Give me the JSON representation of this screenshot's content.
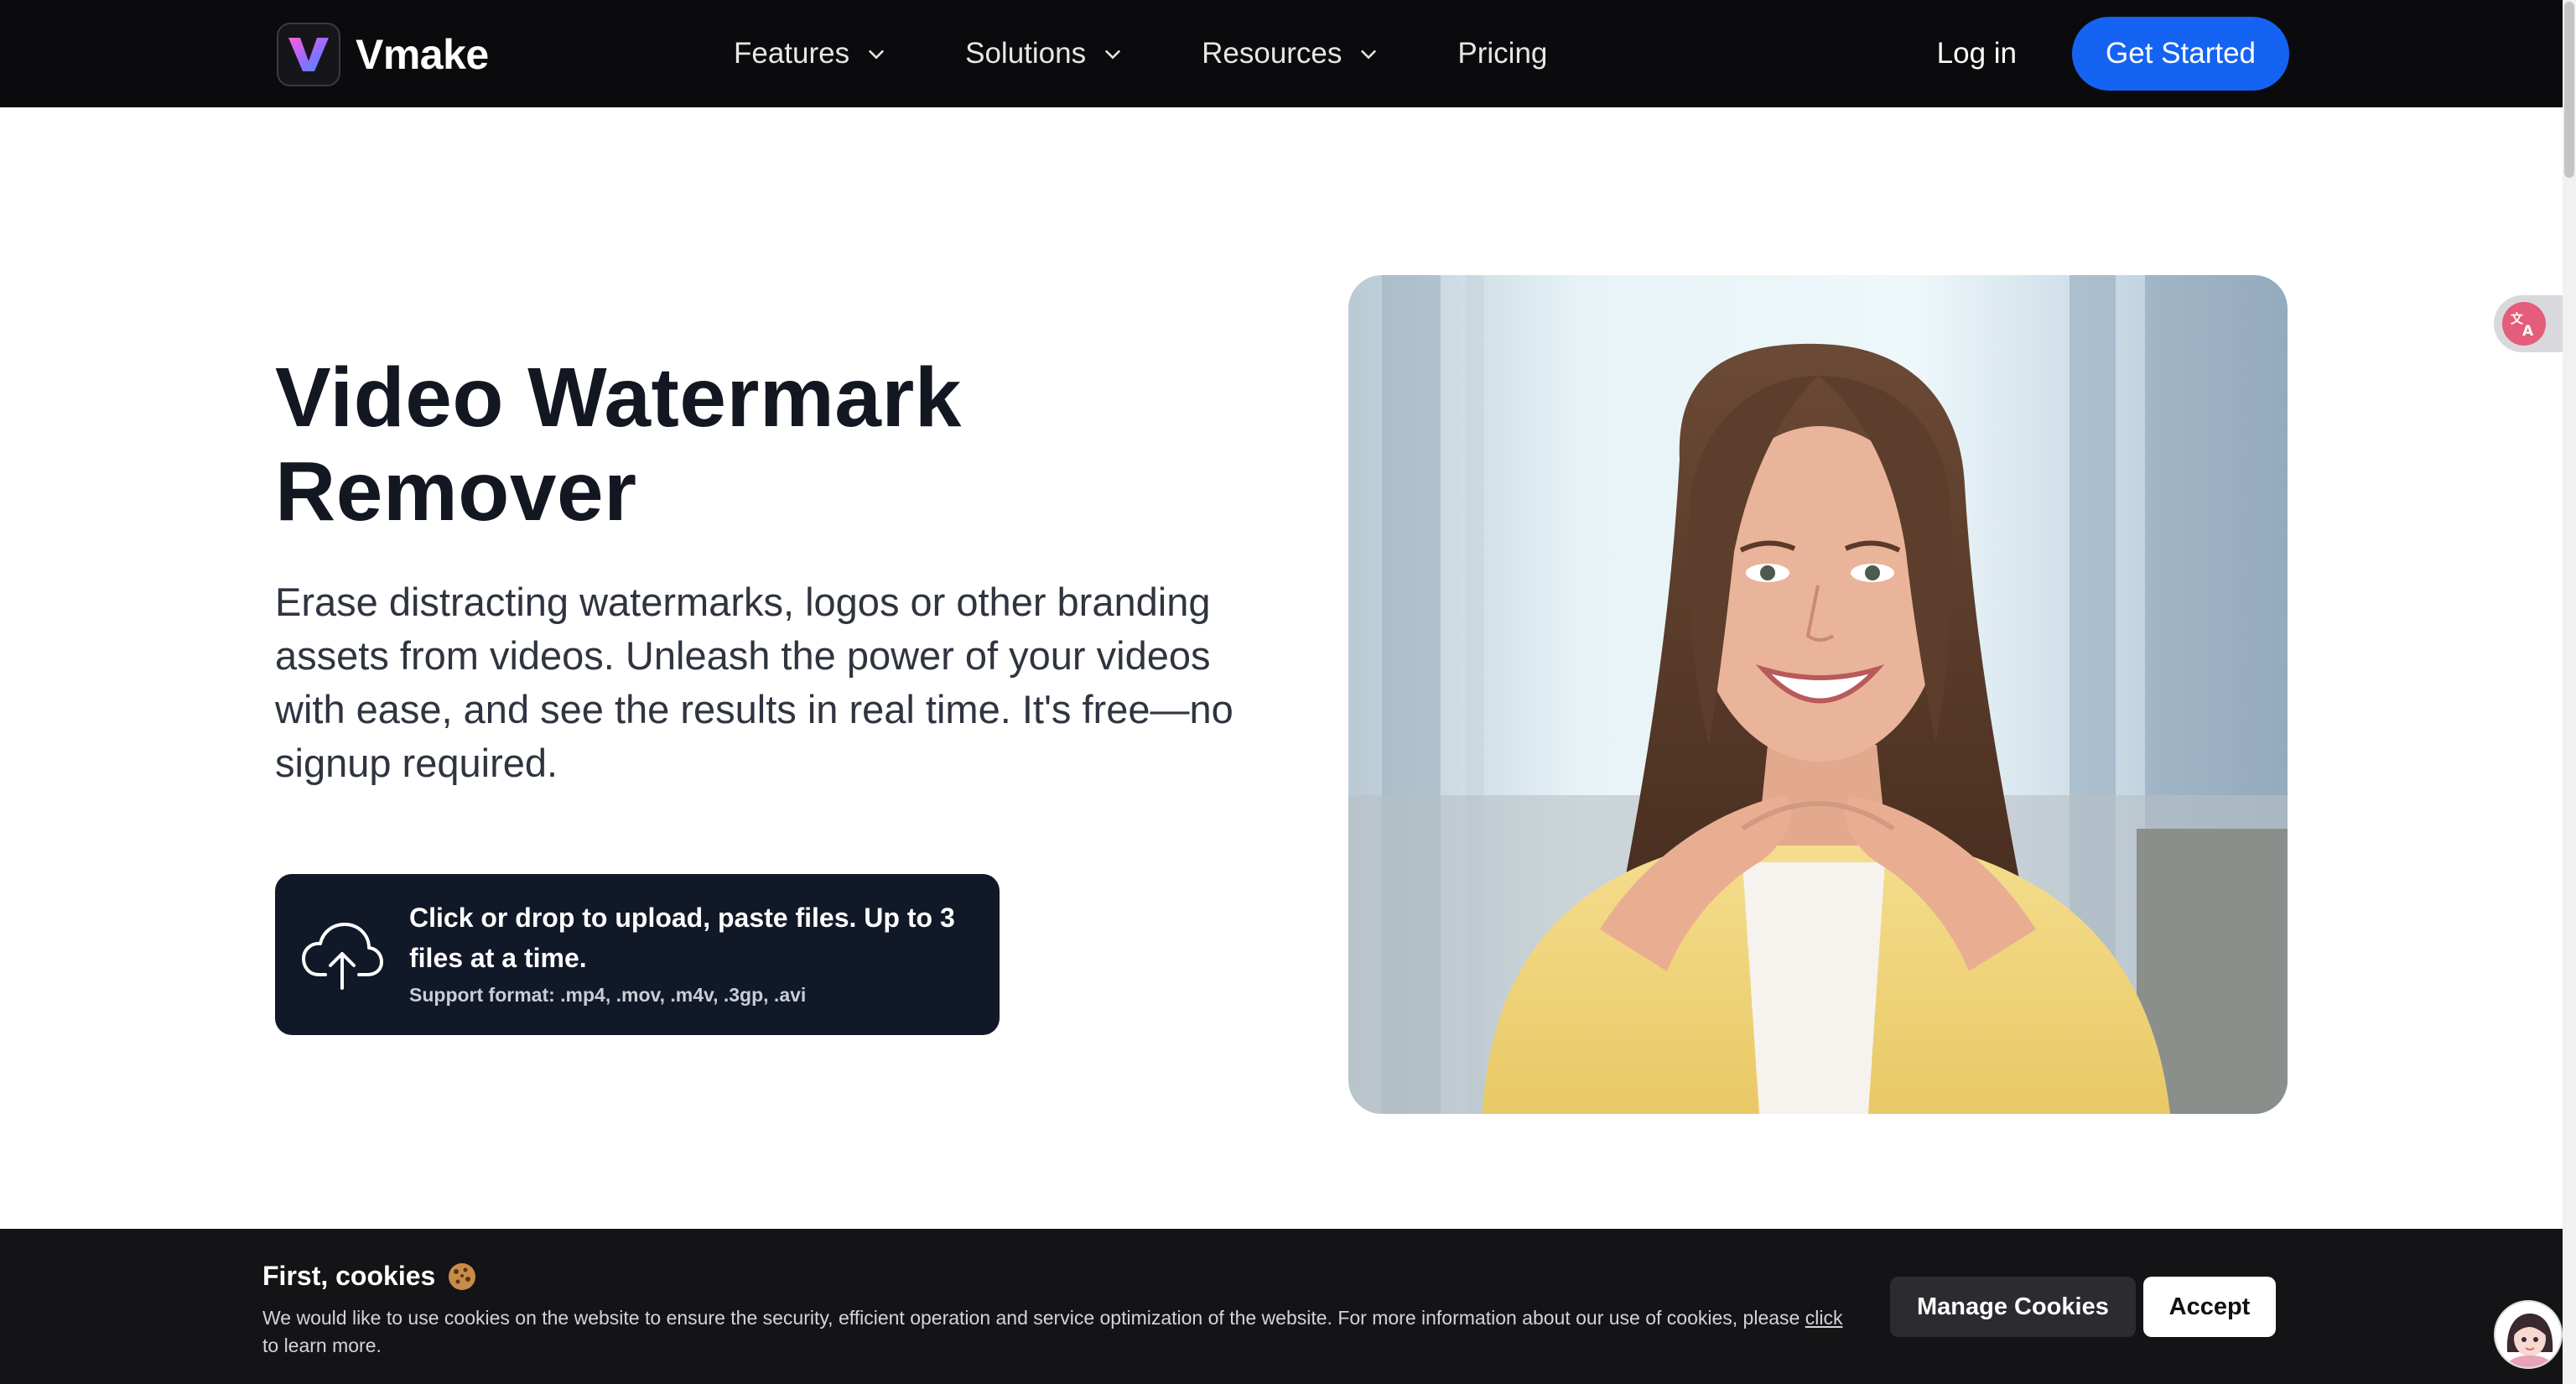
{
  "colors": {
    "nav_bg": "#0b0b0d",
    "primary": "#1463f3",
    "title": "#131722",
    "upload_bg": "#111827",
    "cookie_bg": "#141416"
  },
  "nav": {
    "brand": "Vmake",
    "logo_icon": "vmake-v-logo",
    "items": [
      {
        "label": "Features",
        "icon": "chevron-down-icon"
      },
      {
        "label": "Solutions",
        "icon": "chevron-down-icon"
      },
      {
        "label": "Resources",
        "icon": "chevron-down-icon"
      },
      {
        "label": "Pricing"
      }
    ],
    "login": "Log in",
    "cta": "Get Started"
  },
  "hero": {
    "title": "Video Watermark Remover",
    "description": "Erase distracting watermarks, logos or other branding assets from videos. Unleash the power of your videos with ease, and see the results in real time. It's free—no signup required.",
    "upload": {
      "icon": "cloud-upload-icon",
      "main": "Click or drop to upload, paste files. Up to 3 files at a time.",
      "formats": "Support format: .mp4, .mov, .m4v, .3gp, .avi"
    }
  },
  "translate_widget": {
    "icon": "translate-icon"
  },
  "cookie": {
    "title": "First, cookies",
    "emoji_icon": "cookie-icon",
    "text_before": "We would like to use cookies on the website to ensure the security, efficient operation and service optimization of the website. For more information about our use of cookies, please",
    "link": "click",
    "text_after": "to learn more.",
    "manage": "Manage Cookies",
    "accept": "Accept"
  },
  "chat": {
    "icon": "assistant-avatar-icon"
  }
}
